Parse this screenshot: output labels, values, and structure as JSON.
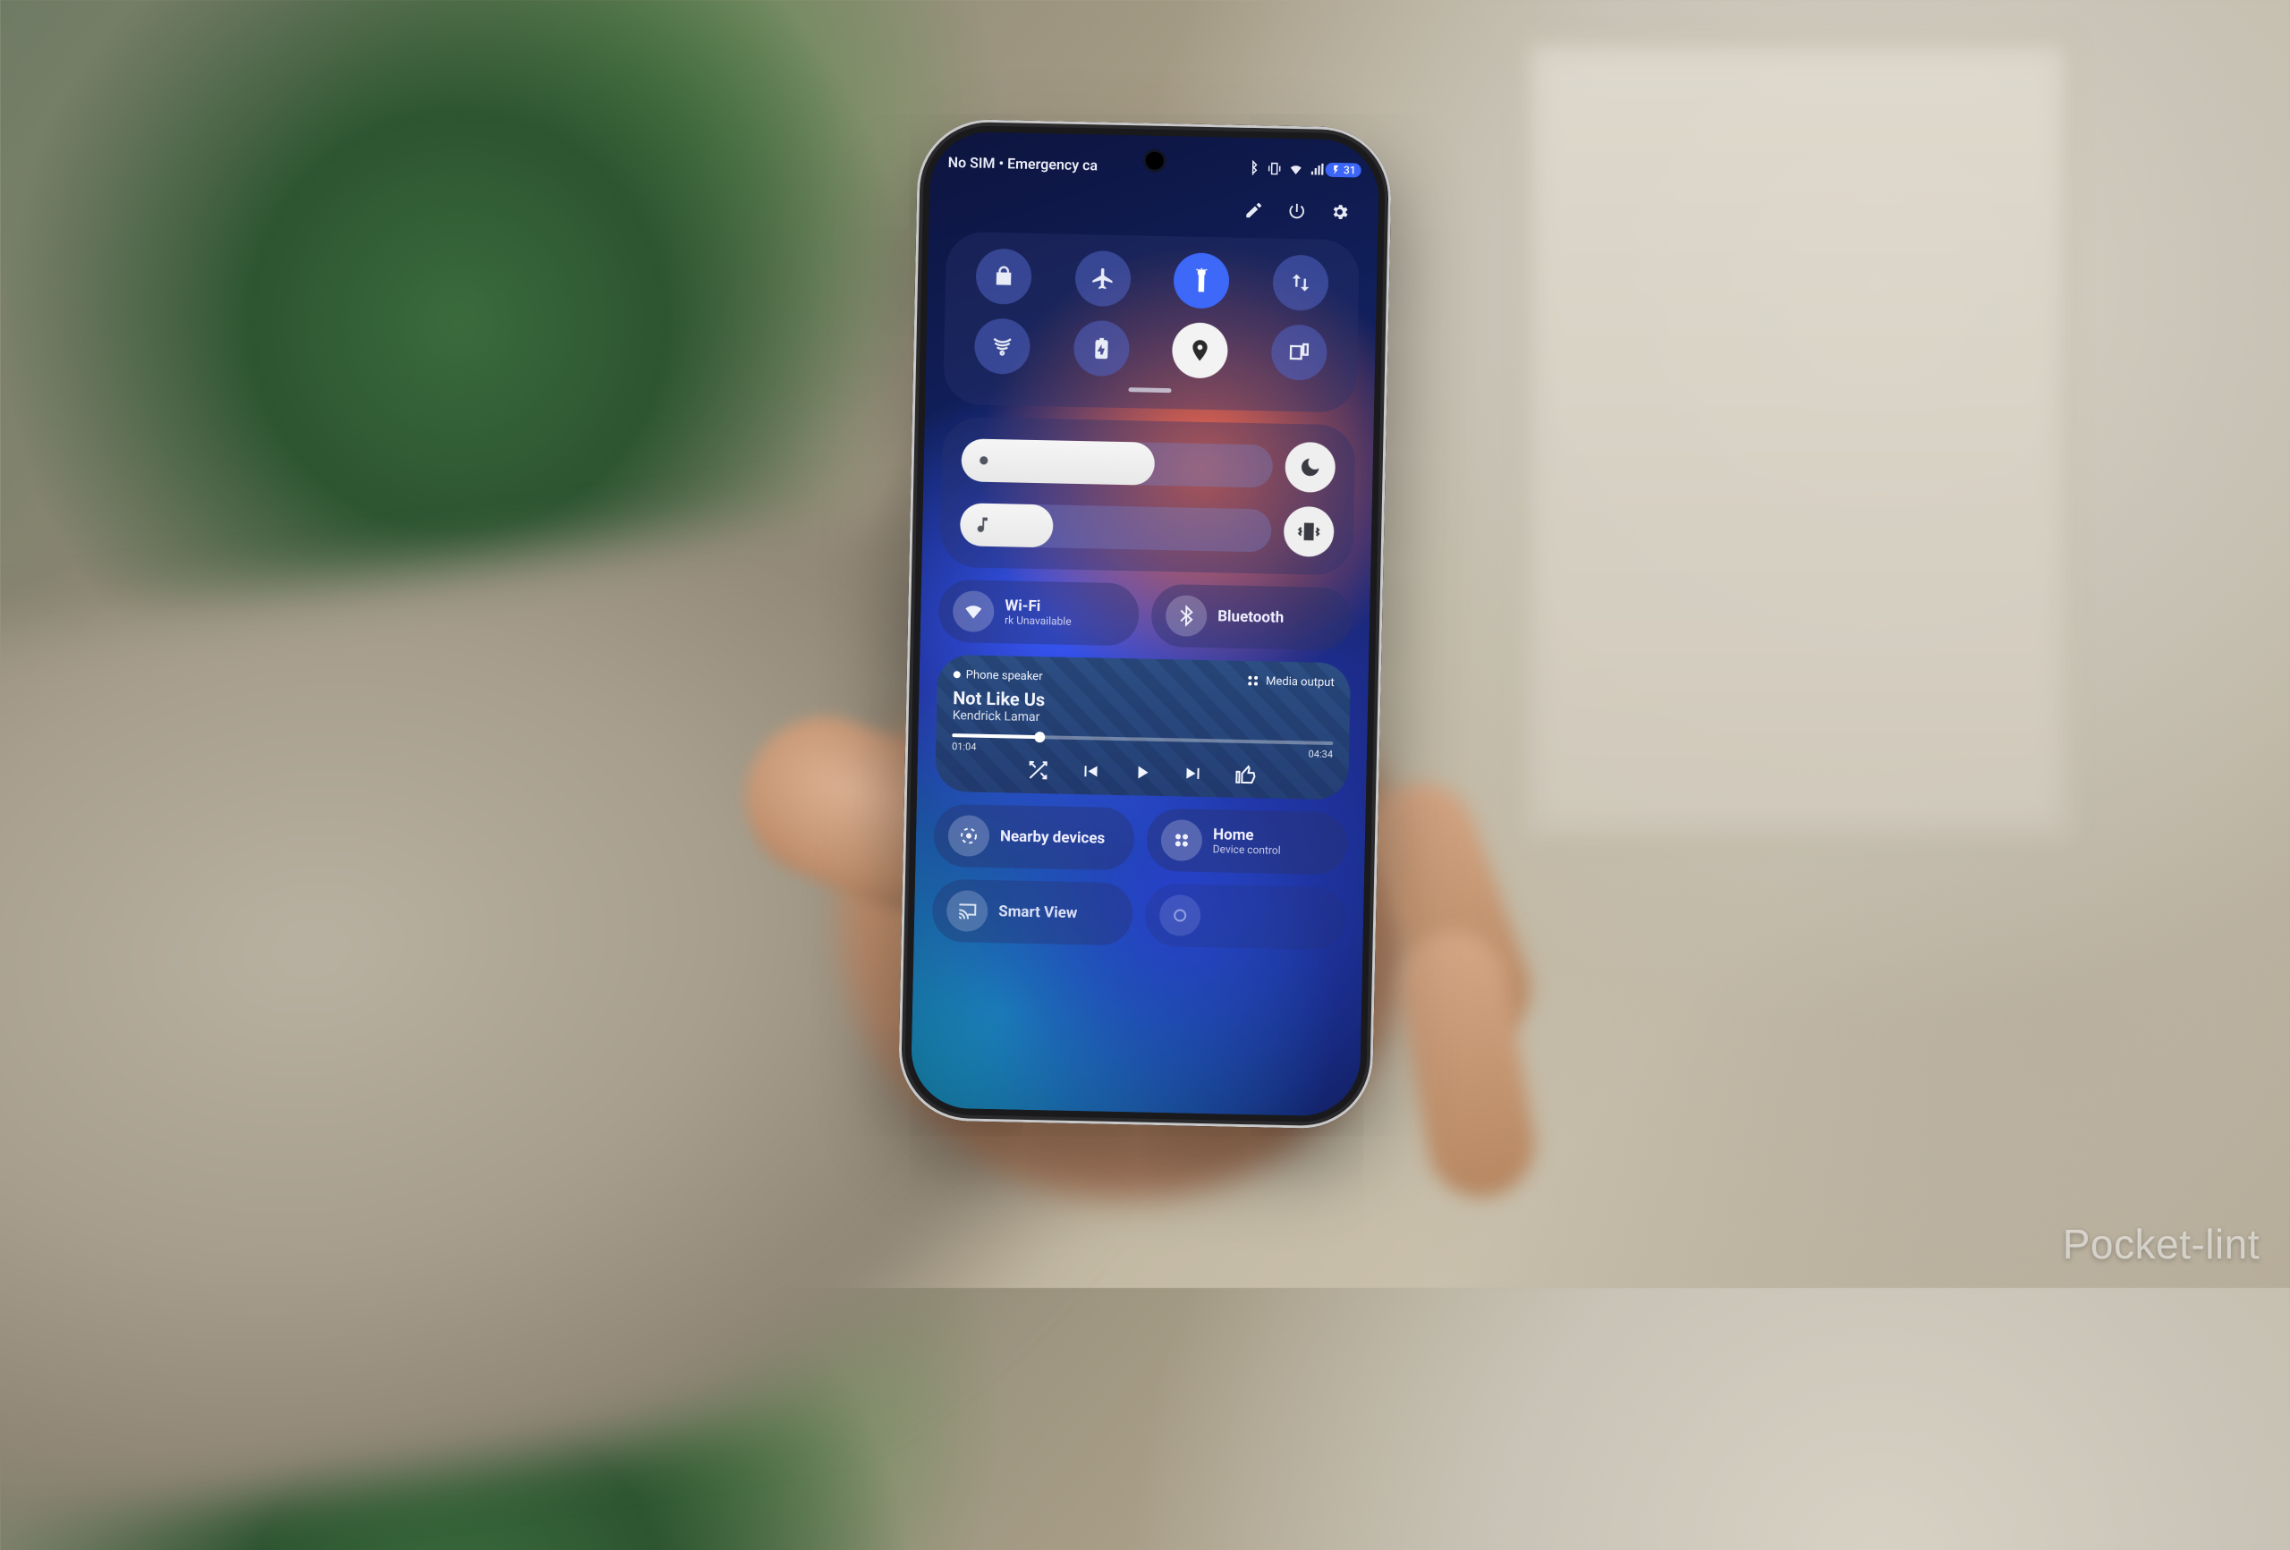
{
  "watermark": "Pocket-lint",
  "status": {
    "text": "No SIM • Emergency ca",
    "battery": "31"
  },
  "toolbar_icons": [
    "edit",
    "power",
    "settings"
  ],
  "quick_toggles": [
    {
      "name": "rotation-lock",
      "state": "off"
    },
    {
      "name": "airplane-mode",
      "state": "off"
    },
    {
      "name": "flashlight",
      "state": "active"
    },
    {
      "name": "data-transfer",
      "state": "off"
    },
    {
      "name": "hotspot",
      "state": "off"
    },
    {
      "name": "battery-saver",
      "state": "off"
    },
    {
      "name": "location",
      "state": "on"
    },
    {
      "name": "multi-window",
      "state": "off"
    }
  ],
  "sliders": {
    "brightness_pct": 62,
    "volume_pct": 30,
    "dnd_icon": "moon",
    "mute_icon": "vibrate"
  },
  "wifi": {
    "title": "Wi-Fi",
    "subtitle": "rk Unavailable"
  },
  "bluetooth": {
    "title": "Bluetooth",
    "subtitle": ""
  },
  "media": {
    "source": "Phone speaker",
    "output_label": "Media output",
    "track": "Not Like Us",
    "artist": "Kendrick Lamar",
    "elapsed": "01:04",
    "total": "04:34",
    "progress_pct": 23
  },
  "bottom": {
    "nearby": {
      "title": "Nearby devices",
      "subtitle": ""
    },
    "home": {
      "title": "Home",
      "subtitle": "Device control"
    },
    "smartview": {
      "title": "Smart View"
    }
  }
}
